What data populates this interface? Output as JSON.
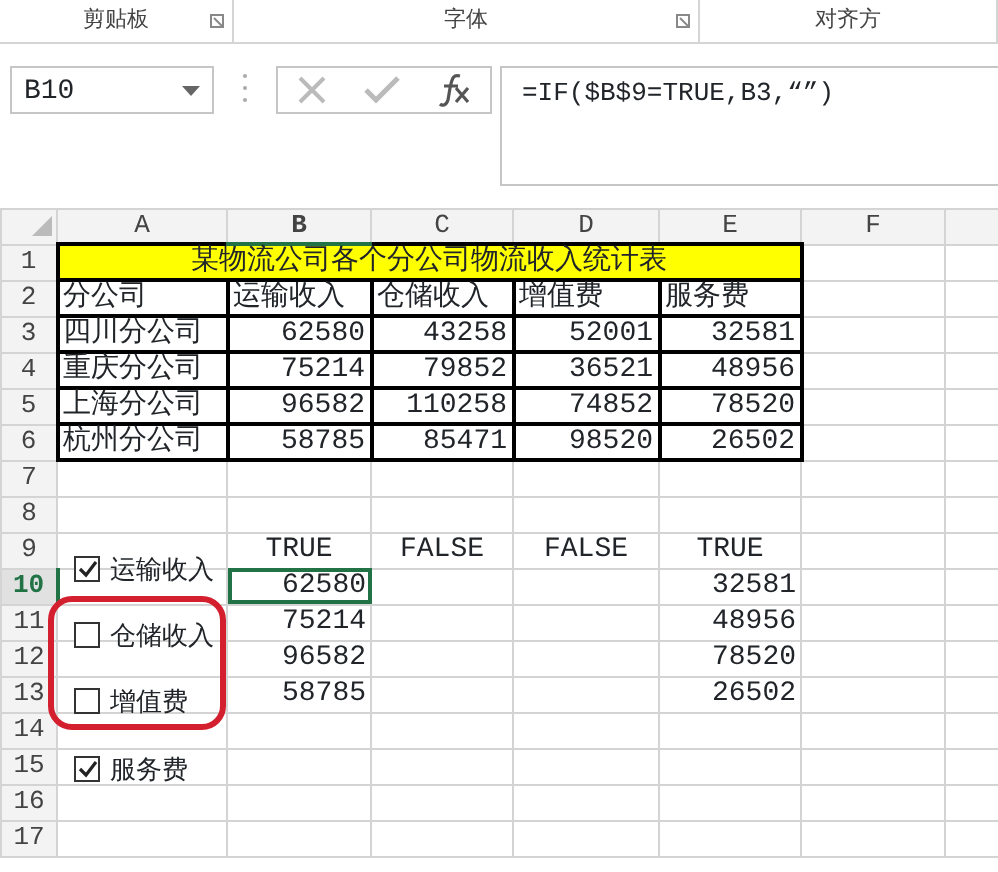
{
  "ribbon_groups": [
    {
      "label": "剪贴板",
      "launcher": true
    },
    {
      "label": "字体",
      "launcher": true
    },
    {
      "label": "对齐方",
      "launcher": false
    }
  ],
  "formula_bar": {
    "name_box": "B10",
    "formula": "=IF($B$9=TRUE,B3,“”)"
  },
  "columns": [
    {
      "label": "A",
      "selected": false
    },
    {
      "label": "B",
      "selected": true
    },
    {
      "label": "C",
      "selected": false
    },
    {
      "label": "D",
      "selected": false
    },
    {
      "label": "E",
      "selected": false
    },
    {
      "label": "F",
      "selected": false
    }
  ],
  "rows": [
    {
      "number": "1",
      "selected": false,
      "kind": "title",
      "a": "某物流公司各个分公司物流收入统计表"
    },
    {
      "number": "2",
      "selected": false,
      "kind": "table",
      "a": "分公司",
      "b": "运输收入",
      "c": "仓储收入",
      "d": "增值费",
      "e": "服务费"
    },
    {
      "number": "3",
      "selected": false,
      "kind": "table",
      "a": "四川分公司",
      "b": "62580",
      "c": "43258",
      "d": "52001",
      "e": "32581"
    },
    {
      "number": "4",
      "selected": false,
      "kind": "table",
      "a": "重庆分公司",
      "b": "75214",
      "c": "79852",
      "d": "36521",
      "e": "48956"
    },
    {
      "number": "5",
      "selected": false,
      "kind": "table",
      "a": "上海分公司",
      "b": "96582",
      "c": "110258",
      "d": "74852",
      "e": "78520"
    },
    {
      "number": "6",
      "selected": false,
      "kind": "table",
      "a": "杭州分公司",
      "b": "58785",
      "c": "85471",
      "d": "98520",
      "e": "26502"
    },
    {
      "number": "7",
      "selected": false,
      "kind": "plain"
    },
    {
      "number": "8",
      "selected": false,
      "kind": "plain"
    },
    {
      "number": "9",
      "selected": false,
      "kind": "flags",
      "b": "TRUE",
      "c": "FALSE",
      "d": "FALSE",
      "e": "TRUE"
    },
    {
      "number": "10",
      "selected": true,
      "kind": "plain",
      "b": "62580",
      "e": "32581"
    },
    {
      "number": "11",
      "selected": false,
      "kind": "plain",
      "b": "75214",
      "e": "48956"
    },
    {
      "number": "12",
      "selected": false,
      "kind": "plain",
      "b": "96582",
      "e": "78520"
    },
    {
      "number": "13",
      "selected": false,
      "kind": "plain",
      "b": "58785",
      "e": "26502"
    },
    {
      "number": "14",
      "selected": false,
      "kind": "plain"
    },
    {
      "number": "15",
      "selected": false,
      "kind": "plain"
    },
    {
      "number": "16",
      "selected": false,
      "kind": "plain"
    },
    {
      "number": "17",
      "selected": false,
      "kind": "plain"
    }
  ],
  "checkboxes": [
    {
      "label": "运输收入",
      "checked": true
    },
    {
      "label": "仓储收入",
      "checked": false
    },
    {
      "label": "增值费",
      "checked": false
    },
    {
      "label": "服务费",
      "checked": true
    }
  ]
}
